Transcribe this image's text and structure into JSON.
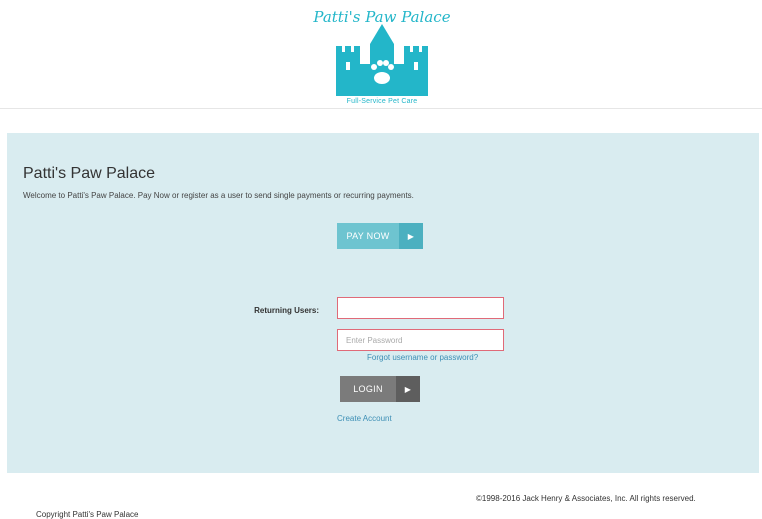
{
  "logo": {
    "title": "Patti's Paw Palace",
    "subtitle": "Full-Service Pet Care",
    "icon": "castle-paw-icon",
    "color": "#23b6c9"
  },
  "panel": {
    "title": "Patti's Paw Palace",
    "welcome": "Welcome to Patti's Paw Palace.  Pay Now or register as a user to send single payments or recurring payments.",
    "background": "#d9ecf0"
  },
  "pay_now": {
    "label": "PAY NOW",
    "arrow": "▶"
  },
  "login_form": {
    "returning_label": "Returning Users:",
    "username_value": "",
    "username_placeholder": "",
    "password_placeholder": "Enter Password",
    "forgot_link": "Forgot username or password?",
    "login_label": "LOGIN",
    "login_arrow": "▶",
    "create_account": "Create Account"
  },
  "footer": {
    "rights": "©1998-2016 Jack Henry & Associates, Inc. All rights reserved.",
    "copyright": "Copyright Patti's Paw Palace"
  }
}
